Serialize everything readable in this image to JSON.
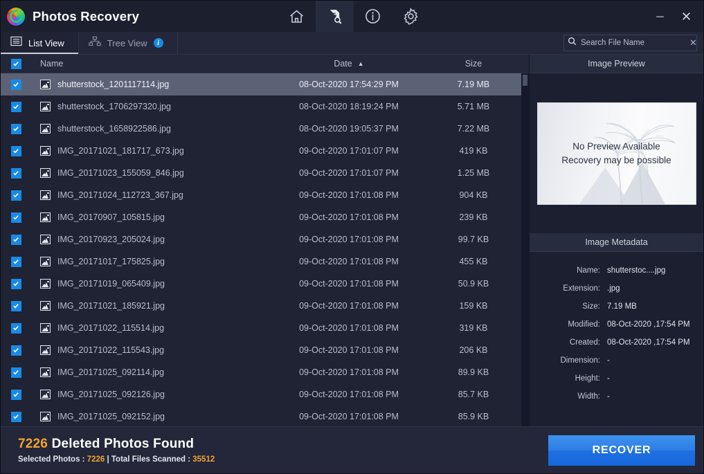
{
  "window": {
    "title": "Photos Recovery",
    "logo_icon": "recovery-circle-logo",
    "minimize_label": "–",
    "close_label": "✕",
    "toolbar_icons": [
      {
        "name": "home-icon",
        "active": false
      },
      {
        "name": "file-search-icon",
        "active": true
      },
      {
        "name": "info-icon",
        "active": false
      },
      {
        "name": "settings-gear-icon",
        "active": false
      }
    ]
  },
  "tabs": [
    {
      "label": "List View",
      "icon": "list-view-icon",
      "active": true
    },
    {
      "label": "Tree View",
      "icon": "tree-view-icon",
      "active": false,
      "badge": "i"
    }
  ],
  "search": {
    "placeholder": "Search File Name",
    "value": "",
    "icon": "search-icon",
    "clear_label": "✕"
  },
  "list": {
    "columns": {
      "name": "Name",
      "date": "Date",
      "size": "Size",
      "sort_arrow": "▲",
      "sort_column": "Date",
      "sort_direction": "ascending"
    },
    "select_all_checked": true,
    "rows": [
      {
        "name": "shutterstock_1201117114.jpg",
        "date": "08-Oct-2020 17:54:29 PM",
        "size": "7.19 MB",
        "checked": true,
        "selected": true
      },
      {
        "name": "shutterstock_1706297320.jpg",
        "date": "08-Oct-2020 18:19:24 PM",
        "size": "5.71 MB",
        "checked": true,
        "selected": false
      },
      {
        "name": "shutterstock_1658922586.jpg",
        "date": "08-Oct-2020 19:05:37 PM",
        "size": "7.22 MB",
        "checked": true,
        "selected": false
      },
      {
        "name": "IMG_20171021_181717_673.jpg",
        "date": "09-Oct-2020 17:01:07 PM",
        "size": "419 KB",
        "checked": true,
        "selected": false
      },
      {
        "name": "IMG_20171023_155059_846.jpg",
        "date": "09-Oct-2020 17:01:07 PM",
        "size": "1.25 MB",
        "checked": true,
        "selected": false
      },
      {
        "name": "IMG_20171024_112723_367.jpg",
        "date": "09-Oct-2020 17:01:08 PM",
        "size": "904 KB",
        "checked": true,
        "selected": false
      },
      {
        "name": "IMG_20170907_105815.jpg",
        "date": "09-Oct-2020 17:01:08 PM",
        "size": "239 KB",
        "checked": true,
        "selected": false
      },
      {
        "name": "IMG_20170923_205024.jpg",
        "date": "09-Oct-2020 17:01:08 PM",
        "size": "99.7 KB",
        "checked": true,
        "selected": false
      },
      {
        "name": "IMG_20171017_175825.jpg",
        "date": "09-Oct-2020 17:01:08 PM",
        "size": "455 KB",
        "checked": true,
        "selected": false
      },
      {
        "name": "IMG_20171019_065409.jpg",
        "date": "09-Oct-2020 17:01:08 PM",
        "size": "50.9 KB",
        "checked": true,
        "selected": false
      },
      {
        "name": "IMG_20171021_185921.jpg",
        "date": "09-Oct-2020 17:01:08 PM",
        "size": "159 KB",
        "checked": true,
        "selected": false
      },
      {
        "name": "IMG_20171022_115514.jpg",
        "date": "09-Oct-2020 17:01:08 PM",
        "size": "319 KB",
        "checked": true,
        "selected": false
      },
      {
        "name": "IMG_20171022_115543.jpg",
        "date": "09-Oct-2020 17:01:08 PM",
        "size": "206 KB",
        "checked": true,
        "selected": false
      },
      {
        "name": "IMG_20171025_092114.jpg",
        "date": "09-Oct-2020 17:01:08 PM",
        "size": "89.9 KB",
        "checked": true,
        "selected": false
      },
      {
        "name": "IMG_20171025_092126.jpg",
        "date": "09-Oct-2020 17:01:08 PM",
        "size": "85.7 KB",
        "checked": true,
        "selected": false
      },
      {
        "name": "IMG_20171025_092152.jpg",
        "date": "09-Oct-2020 17:01:08 PM",
        "size": "85.9 KB",
        "checked": true,
        "selected": false
      }
    ]
  },
  "preview": {
    "header": "Image Preview",
    "placeholder_line1": "No Preview Available",
    "placeholder_line2": "Recovery may be possible"
  },
  "metadata": {
    "header": "Image Metadata",
    "fields": [
      {
        "key": "Name:",
        "value": "shutterstoc....jpg"
      },
      {
        "key": "Extension:",
        "value": ".jpg"
      },
      {
        "key": "Size:",
        "value": "7.19 MB"
      },
      {
        "key": "Modified:",
        "value": "08-Oct-2020 ,17:54 PM"
      },
      {
        "key": "Created:",
        "value": "08-Oct-2020 ,17:54 PM"
      },
      {
        "key": "Dimension:",
        "value": "-"
      },
      {
        "key": "Height:",
        "value": "-"
      },
      {
        "key": "Width:",
        "value": "-"
      }
    ]
  },
  "footer": {
    "found_count": "7226",
    "found_text": "Deleted Photos Found",
    "selected_label": "Selected Photos : ",
    "selected_count": "7226",
    "separator": " | ",
    "scanned_label": "Total Files Scanned : ",
    "scanned_count": "35512",
    "recover_label": "RECOVER"
  },
  "colors": {
    "accent_blue": "#1a8ae5",
    "accent_orange": "#f0a430",
    "window_bg": "#1b1f30",
    "panel_bg": "#1f2334",
    "selected_row": "#5c6275"
  }
}
